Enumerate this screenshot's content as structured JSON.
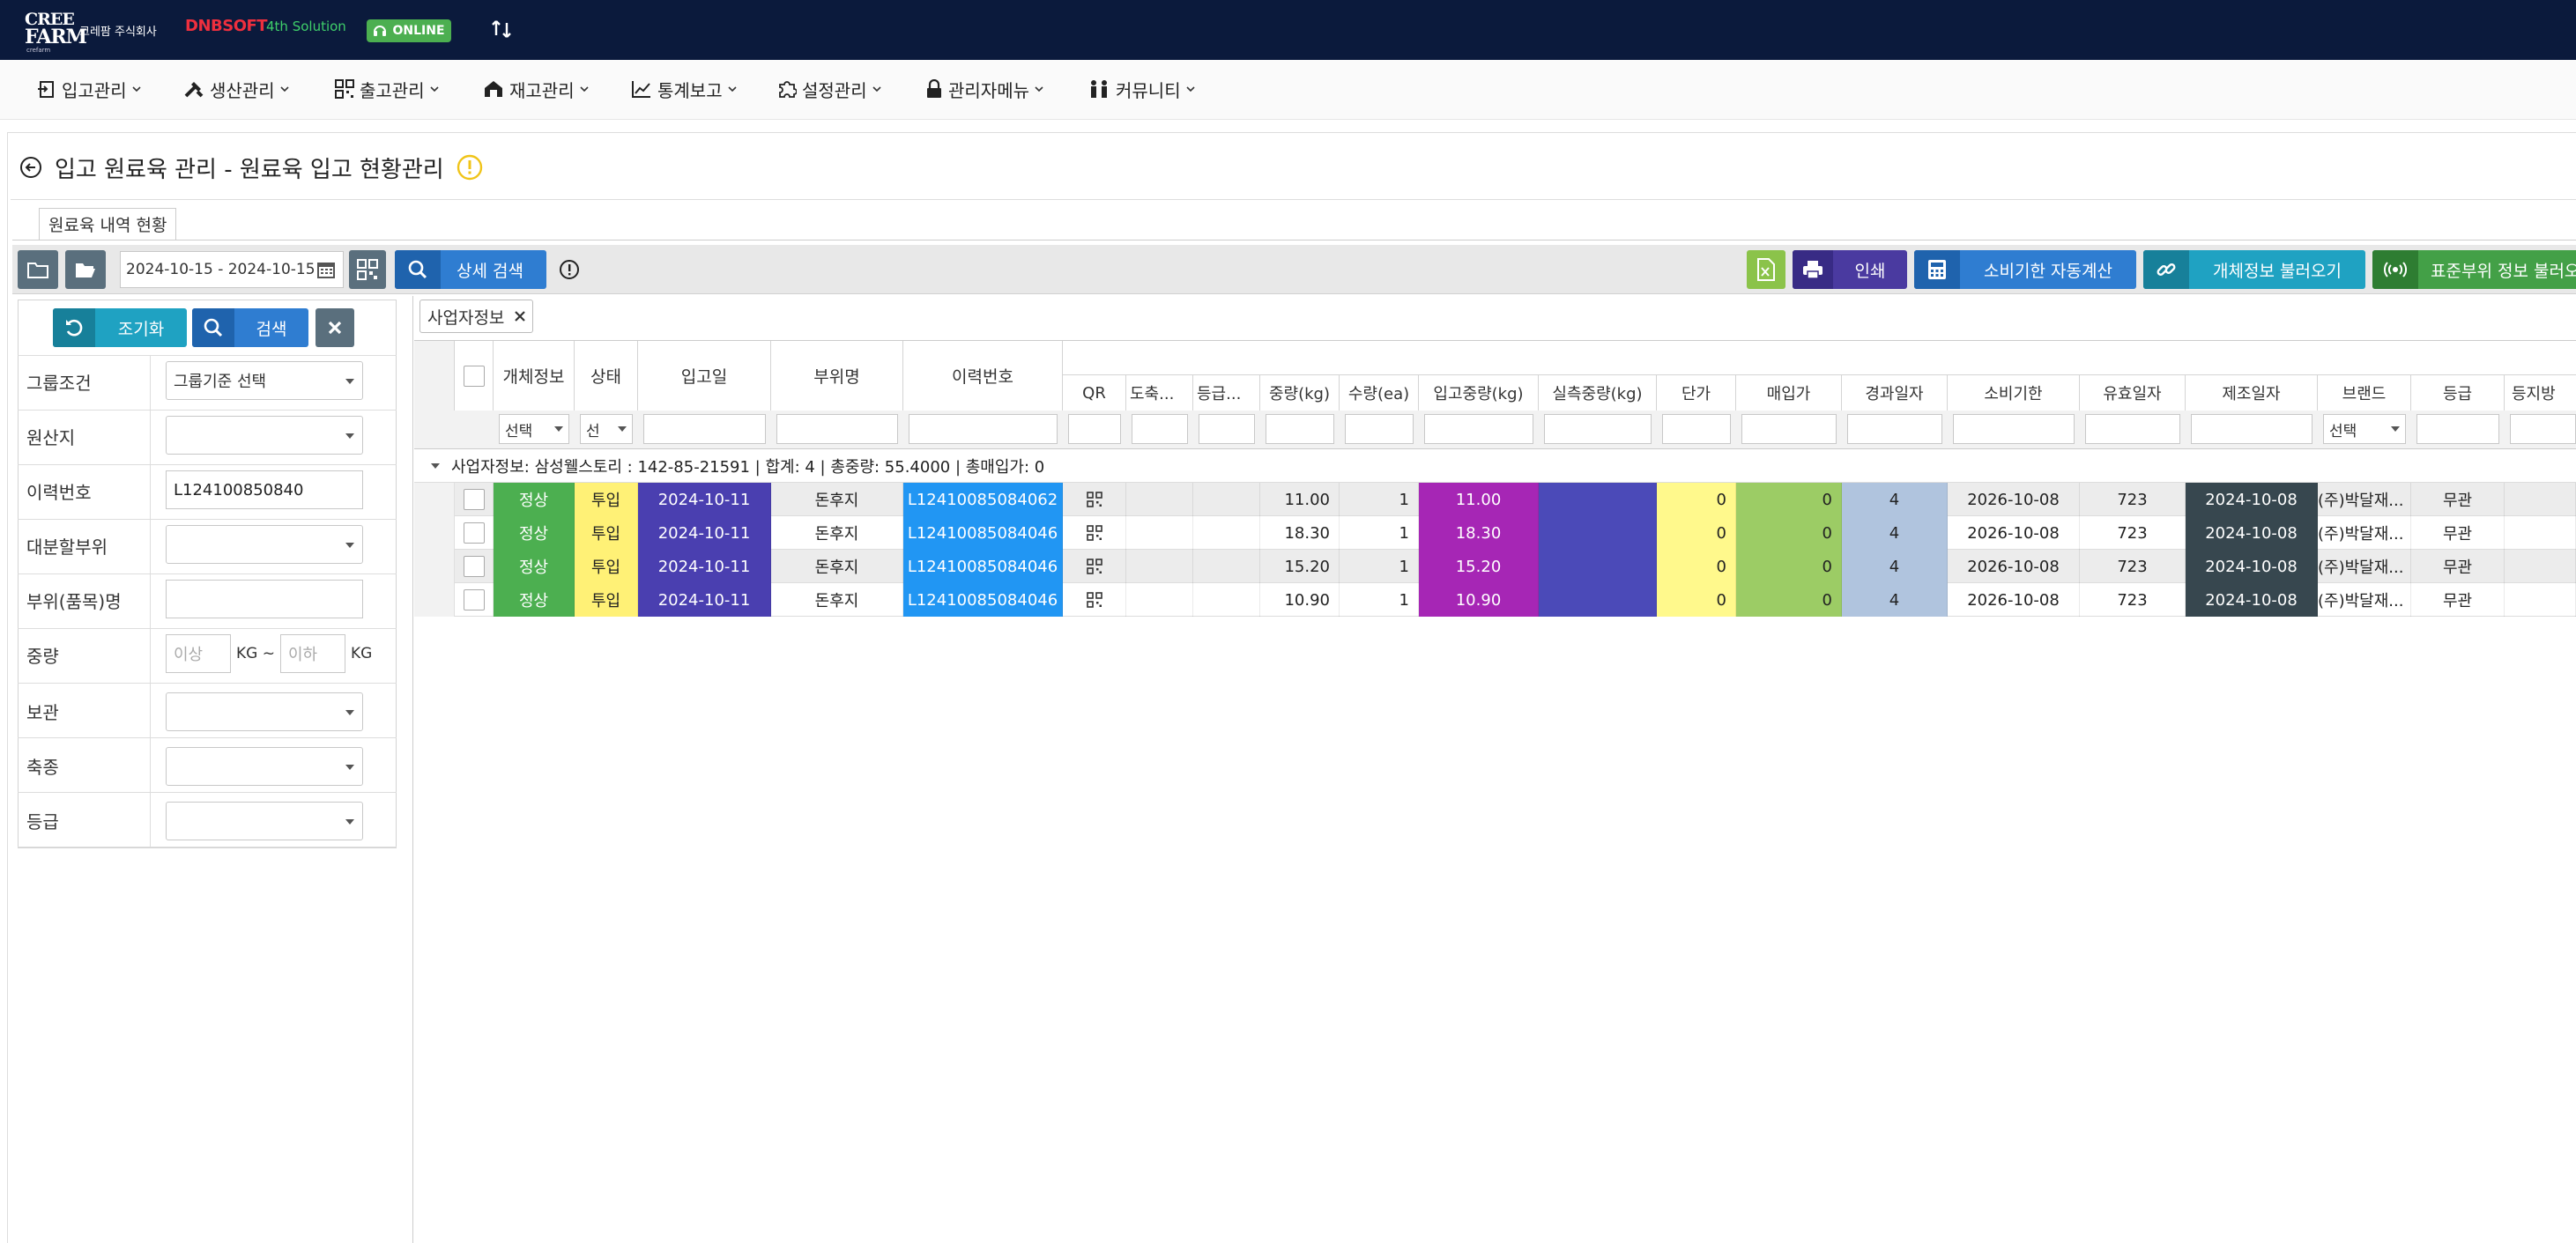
{
  "header": {
    "logo_line1": "CREE",
    "logo_line2": "FARM",
    "logo_sub": "crefarm",
    "company_name": "크레팜 주식회사",
    "brand": "DNBSOFT",
    "brand_solution": "4th Solution",
    "online_label": "ONLINE"
  },
  "menu": [
    {
      "label": "입고관리",
      "icon": "receiving-icon"
    },
    {
      "label": "생산관리",
      "icon": "tools-icon"
    },
    {
      "label": "출고관리",
      "icon": "qr-icon"
    },
    {
      "label": "재고관리",
      "icon": "warehouse-icon"
    },
    {
      "label": "통계보고",
      "icon": "chart-icon"
    },
    {
      "label": "설정관리",
      "icon": "puzzle-icon"
    },
    {
      "label": "관리자메뉴",
      "icon": "lock-icon"
    },
    {
      "label": "커뮤니티",
      "icon": "people-icon"
    }
  ],
  "page": {
    "title": "입고 원료육 관리 - 원료육 입고 현황관리",
    "subtab": "원료육 내역 현황"
  },
  "toolbar": {
    "date_range": "2024-10-15 - 2024-10-15",
    "detail_search": "상세 검색",
    "print": "인쇄",
    "auto_calc": "소비기한 자동계산",
    "load_entity": "개체정보 불러오기",
    "load_standard": "표준부위 정보 불러오기"
  },
  "filters": {
    "reset": "조기화",
    "search": "검색",
    "rows": [
      {
        "label": "그룹조건",
        "type": "select",
        "value": "그룹기준 선택"
      },
      {
        "label": "원산지",
        "type": "select",
        "value": ""
      },
      {
        "label": "이력번호",
        "type": "input",
        "value": "L124100850840"
      },
      {
        "label": "대분할부위",
        "type": "select",
        "value": ""
      },
      {
        "label": "부위(품목)명",
        "type": "input",
        "value": ""
      },
      {
        "label": "중량",
        "type": "range",
        "min_placeholder": "이상",
        "max_placeholder": "이하",
        "unit_mid": "KG ~",
        "unit_end": "KG"
      },
      {
        "label": "보관",
        "type": "select",
        "value": ""
      },
      {
        "label": "축종",
        "type": "select",
        "value": ""
      },
      {
        "label": "등급",
        "type": "select",
        "value": ""
      }
    ]
  },
  "grid": {
    "group_chip": "사업자정보",
    "columns": [
      "개체정보",
      "상태",
      "입고일",
      "부위명",
      "이력번호",
      "QR",
      "도축...",
      "등급...",
      "중량(kg)",
      "수량(ea)",
      "입고중량(kg)",
      "실측중량(kg)",
      "단가",
      "매입가",
      "경과일자",
      "소비기한",
      "유효일자",
      "제조일자",
      "브랜드",
      "등급",
      "등지방"
    ],
    "filter_selects": {
      "entity": "선택",
      "status": "선",
      "brand": "선택"
    },
    "group_row": "사업자정보: 삼성웰스토리 : 142-85-21591 | 합계: 4 | 총중량: 55.4000 | 총매입가: 0",
    "rows": [
      {
        "entity": "정상",
        "status": "투입",
        "date": "2024-10-11",
        "part": "돈후지",
        "trace": "L12410085084062",
        "weight": "11.00",
        "qty": "1",
        "in_weight": "11.00",
        "measured": "",
        "price": "0",
        "purchase": "0",
        "elapsed": "4",
        "expiry": "2026-10-08",
        "valid": "723",
        "mfg": "2024-10-08",
        "brand": "(주)박달재...",
        "grade": "무관"
      },
      {
        "entity": "정상",
        "status": "투입",
        "date": "2024-10-11",
        "part": "돈후지",
        "trace": "L12410085084046",
        "weight": "18.30",
        "qty": "1",
        "in_weight": "18.30",
        "measured": "",
        "price": "0",
        "purchase": "0",
        "elapsed": "4",
        "expiry": "2026-10-08",
        "valid": "723",
        "mfg": "2024-10-08",
        "brand": "(주)박달재...",
        "grade": "무관"
      },
      {
        "entity": "정상",
        "status": "투입",
        "date": "2024-10-11",
        "part": "돈후지",
        "trace": "L12410085084046",
        "weight": "15.20",
        "qty": "1",
        "in_weight": "15.20",
        "measured": "",
        "price": "0",
        "purchase": "0",
        "elapsed": "4",
        "expiry": "2026-10-08",
        "valid": "723",
        "mfg": "2024-10-08",
        "brand": "(주)박달재...",
        "grade": "무관"
      },
      {
        "entity": "정상",
        "status": "투입",
        "date": "2024-10-11",
        "part": "돈후지",
        "trace": "L12410085084046",
        "weight": "10.90",
        "qty": "1",
        "in_weight": "10.90",
        "measured": "",
        "price": "0",
        "purchase": "0",
        "elapsed": "4",
        "expiry": "2026-10-08",
        "valid": "723",
        "mfg": "2024-10-08",
        "brand": "(주)박달재...",
        "grade": "무관"
      }
    ]
  },
  "colors": {
    "topbar": "#0b1a3c",
    "entity_ok": "#4caf50",
    "status_in": "#fff176",
    "date_cell": "#4a3fb0",
    "trace_cell": "#2196f3",
    "in_weight_cell": "#a626b5",
    "measured_cell": "#4b4ab8",
    "price_cell": "#fff98c",
    "purchase_cell": "#9ccc65",
    "elapsed_cell": "#b0c4de",
    "mfg_cell": "#37474f"
  }
}
